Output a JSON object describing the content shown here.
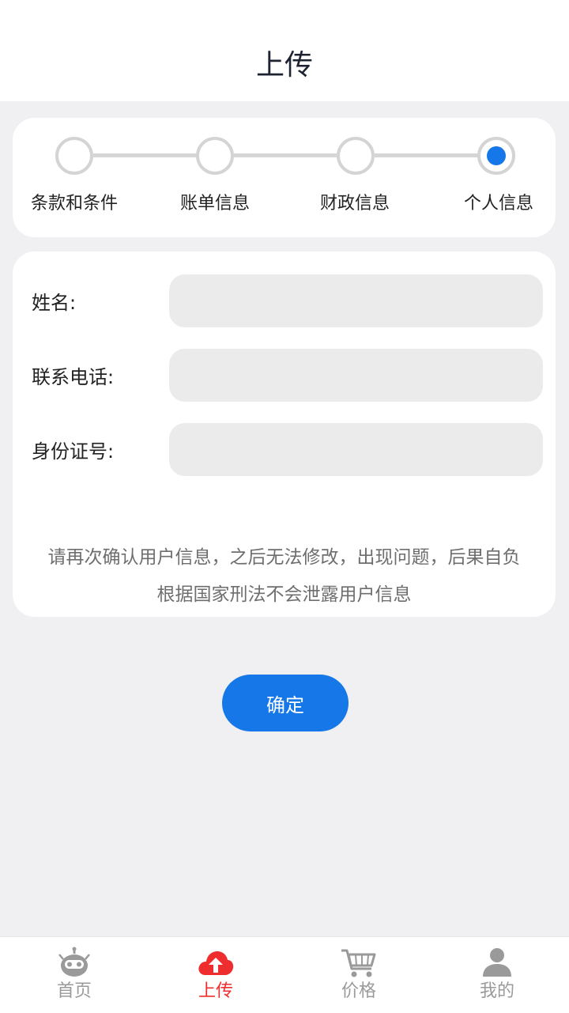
{
  "header": {
    "title": "上传"
  },
  "steps": [
    {
      "label": "条款和条件",
      "state": "inactive"
    },
    {
      "label": "账单信息",
      "state": "inactive"
    },
    {
      "label": "财政信息",
      "state": "inactive"
    },
    {
      "label": "个人信息",
      "state": "active"
    }
  ],
  "form": {
    "fields": [
      {
        "label": "姓名:",
        "value": "",
        "placeholder": ""
      },
      {
        "label": "联系电话:",
        "value": "",
        "placeholder": ""
      },
      {
        "label": "身份证号:",
        "value": "",
        "placeholder": ""
      }
    ],
    "notice_line1": "请再次确认用户信息，之后无法修改，出现问题，后果自负",
    "notice_line2": "根据国家刑法不会泄露用户信息"
  },
  "confirm_label": "确定",
  "tabbar": {
    "items": [
      {
        "label": "首页",
        "icon": "robot-icon",
        "active": false
      },
      {
        "label": "上传",
        "icon": "cloud-upload-icon",
        "active": true
      },
      {
        "label": "价格",
        "icon": "cart-icon",
        "active": false
      },
      {
        "label": "我的",
        "icon": "user-icon",
        "active": false
      }
    ]
  },
  "colors": {
    "accent": "#1677e8",
    "active_tab": "#ee2e2e",
    "inactive_tab": "#9a9a9a",
    "background": "#f0f0f2"
  }
}
